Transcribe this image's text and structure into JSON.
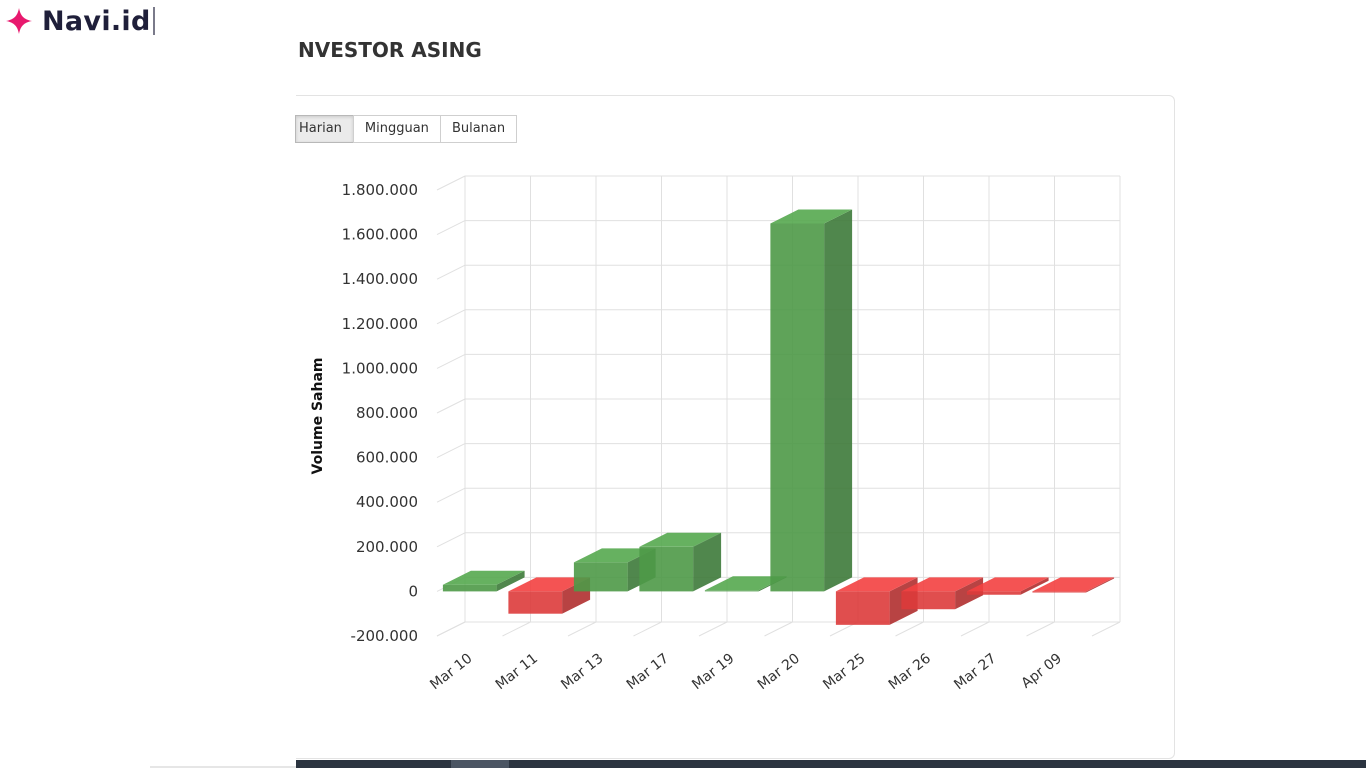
{
  "brand": {
    "name": "Navi.id",
    "accent": "#e8196e"
  },
  "section": {
    "title": "NVESTOR ASING"
  },
  "tabs": [
    {
      "label": "Harian",
      "active": true
    },
    {
      "label": "Mingguan",
      "active": false
    },
    {
      "label": "Bulanan",
      "active": false
    }
  ],
  "chart_data": {
    "type": "bar",
    "ylabel": "Volume Saham",
    "ylim": [
      -200000,
      1800000
    ],
    "ytick_step": 200000,
    "yticks": [
      "-200.000",
      "0",
      "200.000",
      "400.000",
      "600.000",
      "800.000",
      "1.000.000",
      "1.200.000",
      "1.400.000",
      "1.600.000",
      "1.800.000"
    ],
    "categories": [
      "Mar 10",
      "Mar 11",
      "Mar 13",
      "Mar 17",
      "Mar 19",
      "Mar 20",
      "Mar 25",
      "Mar 26",
      "Mar 27",
      "Apr 09"
    ],
    "values": [
      30000,
      -100000,
      130000,
      200000,
      5000,
      1650000,
      -150000,
      -80000,
      -15000,
      -5000
    ],
    "positive_color": "#4e9a48",
    "negative_color": "#dd3b3b",
    "grid": true,
    "legend": "none",
    "three_d": true
  }
}
